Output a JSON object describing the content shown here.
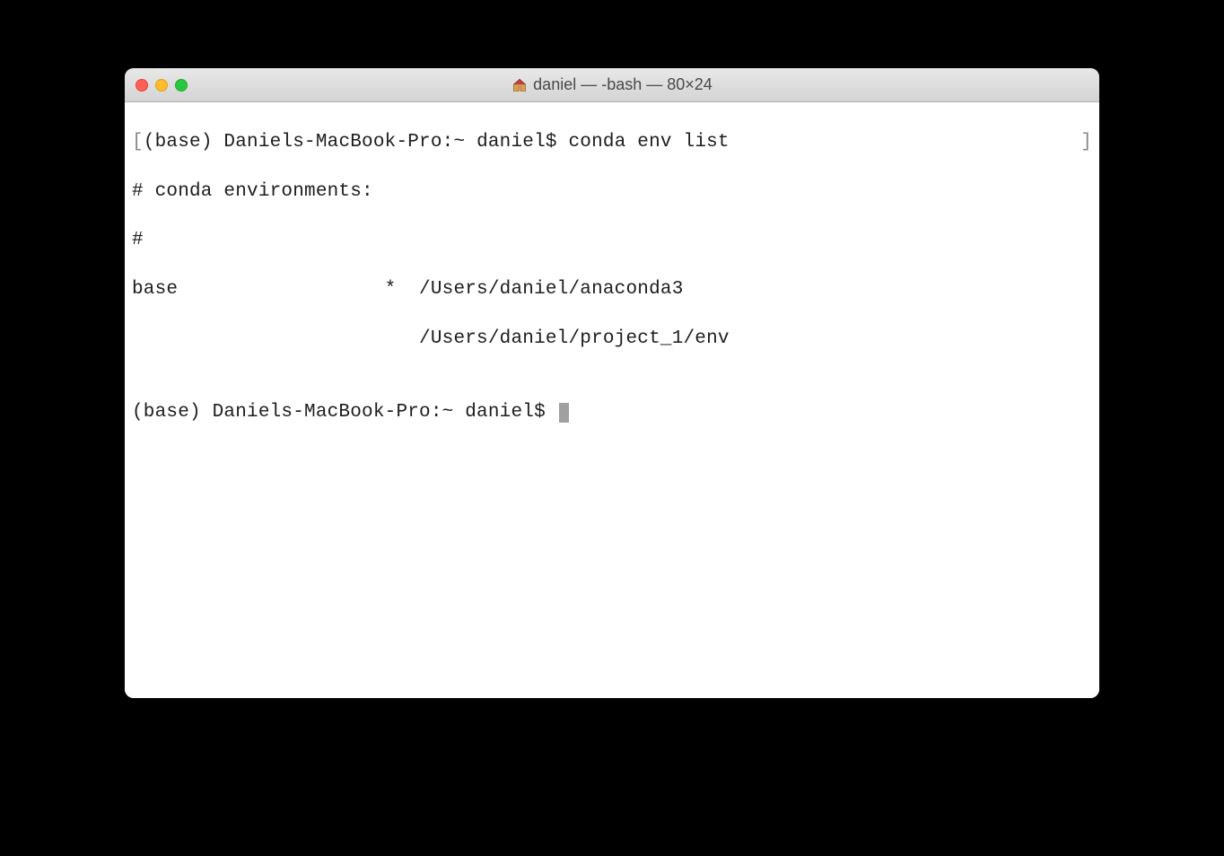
{
  "window": {
    "title": "daniel — -bash — 80×24"
  },
  "terminal": {
    "line1_prefix": "[",
    "line1_prompt": "(base) Daniels-MacBook-Pro:~ daniel$ ",
    "line1_command": "conda env list",
    "line1_suffix": "]",
    "line2": "# conda environments:",
    "line3": "#",
    "line4": "base                  *  /Users/daniel/anaconda3",
    "line5": "                         /Users/daniel/project_1/env",
    "line6": "",
    "line7_prompt": "(base) Daniels-MacBook-Pro:~ daniel$ "
  }
}
